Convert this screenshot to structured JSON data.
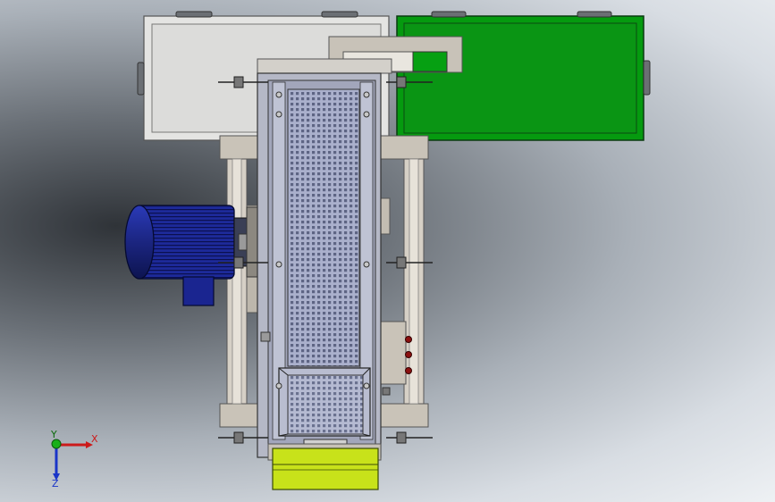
{
  "viewport": {
    "triad": {
      "x_label": "X",
      "y_label": "Y",
      "z_label": "Z"
    }
  },
  "colors": {
    "green_tray": "#059a0f",
    "yellow_hopper": "#c8e21a",
    "motor_blue": "#1d2a9a",
    "frame_steel": "#c9c3b8",
    "mesh_panel": "#a9aeca"
  },
  "icons": [
    "triad-icon"
  ]
}
